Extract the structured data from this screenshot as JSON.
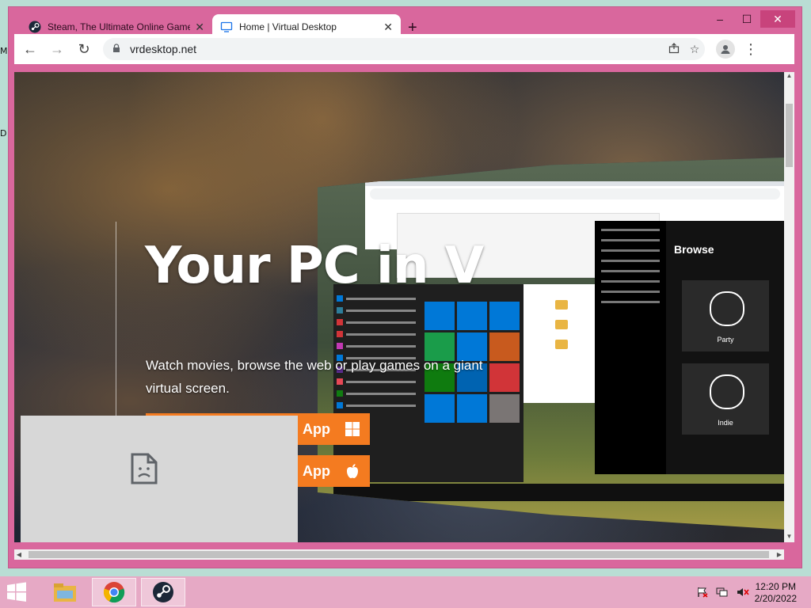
{
  "desktop": {
    "fragments": [
      "M",
      "D"
    ]
  },
  "window": {
    "controls": {
      "minimize": "–",
      "maximize": "☐",
      "close": "✕"
    }
  },
  "tabs": [
    {
      "title": "Steam, The Ultimate Online Game Platform",
      "icon": "steam-icon",
      "close": "✕",
      "active": false
    },
    {
      "title": "Home | Virtual Desktop",
      "icon": "monitor-icon",
      "close": "✕",
      "active": true
    }
  ],
  "new_tab": "+",
  "toolbar": {
    "back": "←",
    "forward": "→",
    "reload": "↻",
    "url": "vrdesktop.net",
    "share_icon": "share-icon",
    "bookmark_icon": "star-icon",
    "profile_icon": "profile-icon",
    "menu_icon": "kebab-menu-icon"
  },
  "page": {
    "hero_title": "Your PC in V",
    "hero_subtitle": "Watch movies, browse the web or play games on a giant virtual screen.",
    "buttons": [
      {
        "label": "App",
        "icon": "windows-icon",
        "color": "#f47b20"
      },
      {
        "label": "App",
        "icon": "apple-icon",
        "color": "#f47b20"
      }
    ],
    "vr_preview": {
      "spotify_heading": "Browse",
      "spotify_cards": [
        "Party",
        "Indie"
      ],
      "tile_colors": [
        "#0078d7",
        "#0078d7",
        "#0078d7",
        "#1a9c4a",
        "#0078d7",
        "#c85a1e",
        "#0f7b0f",
        "#0063b1",
        "#d13438",
        "#0078d7",
        "#0078d7",
        "#7a7574"
      ]
    }
  },
  "taskbar": {
    "time": "12:20 PM",
    "date": "2/20/2022",
    "apps": [
      "file-explorer-icon",
      "chrome-icon",
      "steam-icon"
    ]
  }
}
